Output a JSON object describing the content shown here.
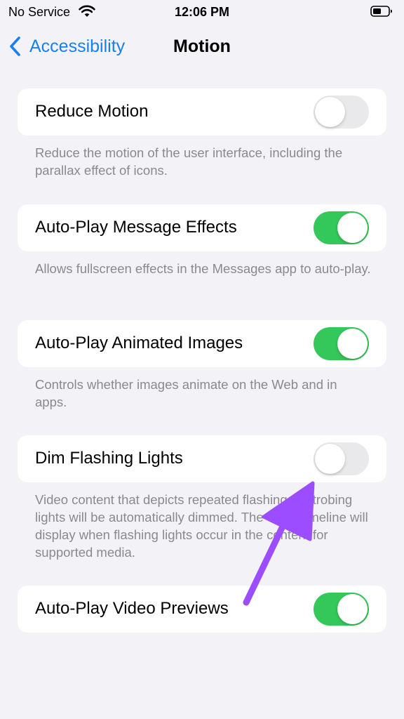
{
  "status_bar": {
    "carrier": "No Service",
    "time": "12:06 PM"
  },
  "nav": {
    "back_label": "Accessibility",
    "title": "Motion"
  },
  "settings": [
    {
      "label": "Reduce Motion",
      "enabled": false,
      "footer": "Reduce the motion of the user interface, including the parallax effect of icons."
    },
    {
      "label": "Auto-Play Message Effects",
      "enabled": true,
      "footer": "Allows fullscreen effects in the Messages app to auto-play."
    },
    {
      "label": "Auto-Play Animated Images",
      "enabled": true,
      "footer": "Controls whether images animate on the Web and in apps."
    },
    {
      "label": "Dim Flashing Lights",
      "enabled": false,
      "footer": "Video content that depicts repeated flashing or strobing lights will be automatically dimmed. The video timeline will display when flashing lights occur in the content for supported media."
    },
    {
      "label": "Auto-Play Video Previews",
      "enabled": true,
      "footer": ""
    }
  ],
  "colors": {
    "accent": "#1a7ff0",
    "toggle_on": "#34c759",
    "toggle_off": "#e9e9eb",
    "annotation_arrow": "#9b4dff"
  },
  "icons": {
    "wifi": "wifi-icon",
    "battery": "battery-icon",
    "back": "chevron-left-icon"
  }
}
